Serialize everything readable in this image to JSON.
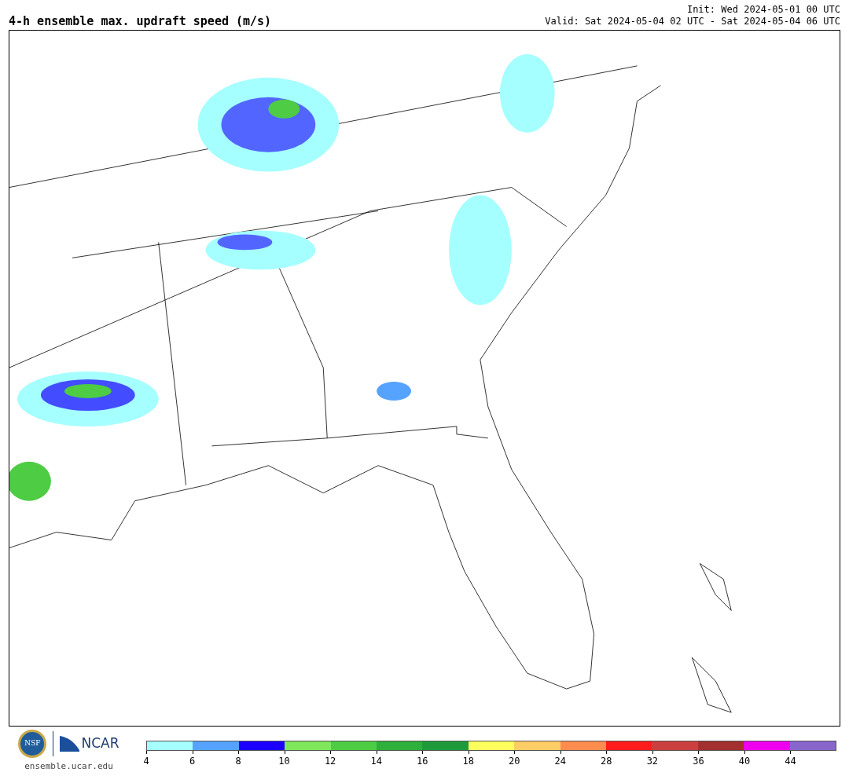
{
  "title": "4-h ensemble max. updraft speed (m/s)",
  "init": "Init: Wed 2024-05-01 00 UTC",
  "valid": "Valid: Sat 2024-05-04 02 UTC - Sat 2024-05-04 06 UTC",
  "logos": {
    "nsf": "NSF",
    "ncar": "NCAR",
    "site": "ensemble.ucar.edu"
  },
  "colorbar": [
    {
      "color": "#a6ffff",
      "label": "4"
    },
    {
      "color": "#55a3ff",
      "label": "6"
    },
    {
      "color": "#1b00ff",
      "label": "8"
    },
    {
      "color": "#80e65c",
      "label": "10"
    },
    {
      "color": "#4dcc44",
      "label": "12"
    },
    {
      "color": "#2eb03b",
      "label": "14"
    },
    {
      "color": "#1f9a3b",
      "label": "16"
    },
    {
      "color": "#ffff5e",
      "label": "18"
    },
    {
      "color": "#ffcc66",
      "label": "20"
    },
    {
      "color": "#ff8c4f",
      "label": "24"
    },
    {
      "color": "#ff1c1c",
      "label": "28"
    },
    {
      "color": "#cc3f3f",
      "label": "32"
    },
    {
      "color": "#a32f2f",
      "label": "36"
    },
    {
      "color": "#ee00ee",
      "label": "40"
    },
    {
      "color": "#8866cc",
      "label": "44"
    }
  ]
}
